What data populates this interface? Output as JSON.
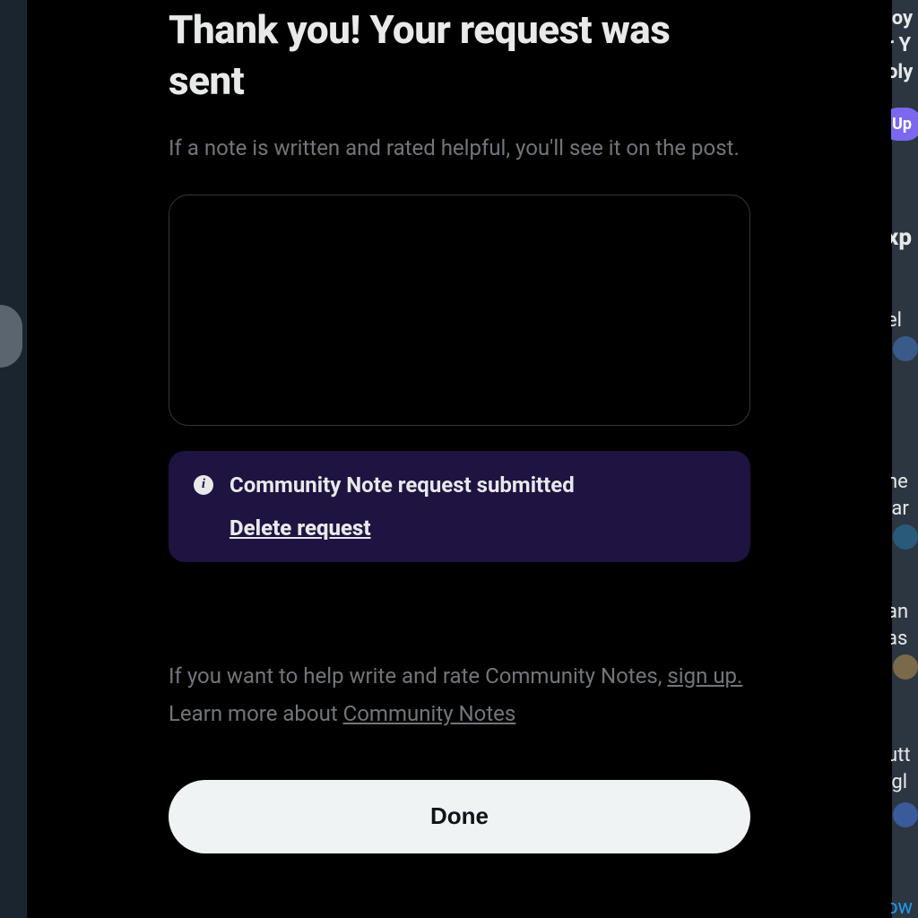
{
  "modal": {
    "title": "Thank you! Your request was sent",
    "subtitle": "If a note is written and rated helpful, you'll see it on the post.",
    "infoBox": {
      "status": "Community Note request submitted",
      "deleteLabel": "Delete request"
    },
    "helpText": "If you want to help write and rate Community Notes, ",
    "signUpLabel": "sign up.",
    "learnPrefix": "Learn more about ",
    "learnLink": "Community Notes",
    "doneLabel": "Done"
  },
  "background": {
    "rightFragments": {
      "f1": "joy",
      "f2": "r Y",
      "f3": "oly",
      "upgradeBtn": "Up",
      "f4": "xp",
      "f5": "el",
      "f6": "ne",
      "f7": "lar",
      "f8": "an",
      "f9": "as",
      "f10": "utt",
      "f11": "igl",
      "f12": "ow"
    }
  }
}
